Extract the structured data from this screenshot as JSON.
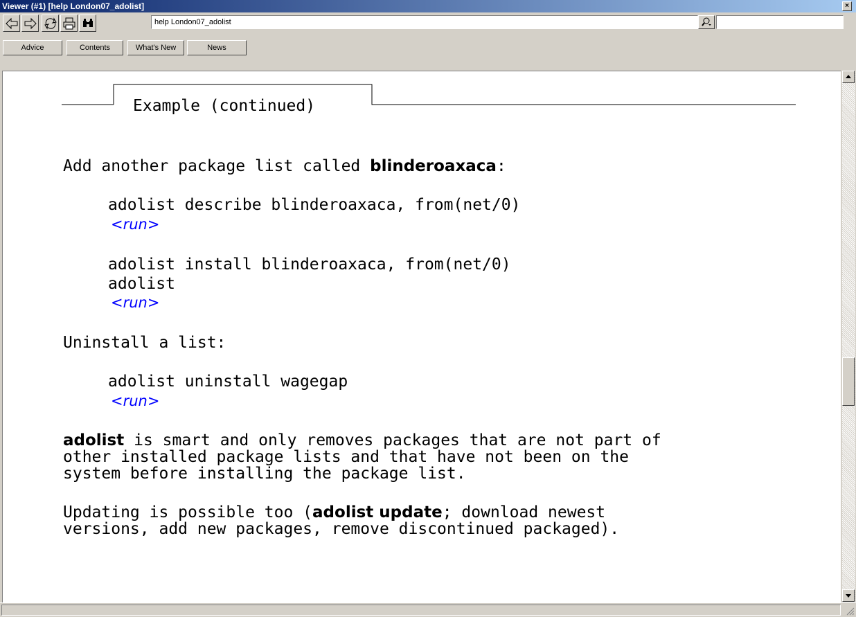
{
  "window": {
    "title": "Viewer (#1) [help London07_adolist]",
    "close_glyph": "×"
  },
  "toolbar": {
    "buttons": [
      "back-arrow-icon",
      "forward-arrow-icon",
      "refresh-icon",
      "print-icon",
      "binoculars-icon"
    ],
    "url_value": "help London07_adolist",
    "search_value": ""
  },
  "nav": {
    "advice": "Advice",
    "contents": "Contents",
    "whats_new": "What's New",
    "news": "News"
  },
  "doc": {
    "section_title": "Example (continued)",
    "add_prefix": "Add another package list called ",
    "add_name": "blinderoaxaca",
    "add_suffix": ":",
    "cmd1": "adolist describe blinderoaxaca, from(net/0)",
    "run1": "<run>",
    "cmd2a": "adolist install blinderoaxaca, from(net/0)",
    "cmd2b": "adolist",
    "run2": "<run>",
    "uninstall_heading": "Uninstall a list:",
    "cmd3": "adolist uninstall wagegap",
    "run3": "<run>",
    "para1_bold": "adolist",
    "para1_line1_rest": " is smart and only removes packages that are not part of",
    "para1_line2": "other installed package lists and that have not been on the",
    "para1_line3": "system before installing the package list.",
    "para2_prefix": "Updating is possible too (",
    "para2_bold": "adolist update",
    "para2_line1_rest": "; download newest",
    "para2_line2": "versions, add new packages, remove discontinued packaged)."
  },
  "colors": {
    "titlebar_start": "#0a246a",
    "titlebar_end": "#a6caf0",
    "link": "#0000ff",
    "chrome": "#d4d0c8"
  }
}
